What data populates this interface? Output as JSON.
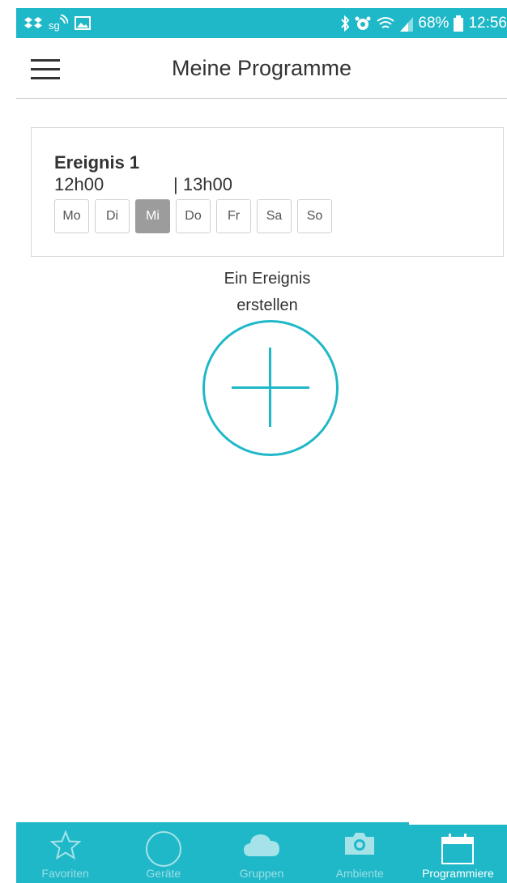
{
  "status_bar": {
    "battery": "68%",
    "time": "12:56",
    "icons": [
      "dropbox-icon",
      "sync-icon",
      "image-icon",
      "bluetooth-icon",
      "alarm-icon",
      "wifi-icon",
      "signal-icon",
      "battery-icon"
    ]
  },
  "header": {
    "title": "Meine Programme",
    "menu_icon": "hamburger-icon"
  },
  "event": {
    "title": "Ereignis 1",
    "start": "12h00",
    "end": "| 13h00",
    "days": [
      {
        "label": "Mo",
        "active": false
      },
      {
        "label": "Di",
        "active": false
      },
      {
        "label": "Mi",
        "active": true
      },
      {
        "label": "Do",
        "active": false
      },
      {
        "label": "Fr",
        "active": false
      },
      {
        "label": "Sa",
        "active": false
      },
      {
        "label": "So",
        "active": false
      }
    ]
  },
  "create": {
    "label_line1": "Ein Ereignis",
    "label_line2": "erstellen",
    "icon": "plus-icon"
  },
  "bottom_nav": {
    "items": [
      {
        "label": "Favoriten",
        "icon": "star-icon",
        "active": false
      },
      {
        "label": "Geräte",
        "icon": "circle-icon",
        "active": false
      },
      {
        "label": "Gruppen",
        "icon": "cloud-icon",
        "active": false
      },
      {
        "label": "Ambiente",
        "icon": "camera-icon",
        "active": false
      },
      {
        "label": "Programmiere",
        "icon": "calendar-icon",
        "active": true
      }
    ]
  },
  "colors": {
    "accent": "#1fb8c8",
    "active_day": "#9c9c9c"
  }
}
